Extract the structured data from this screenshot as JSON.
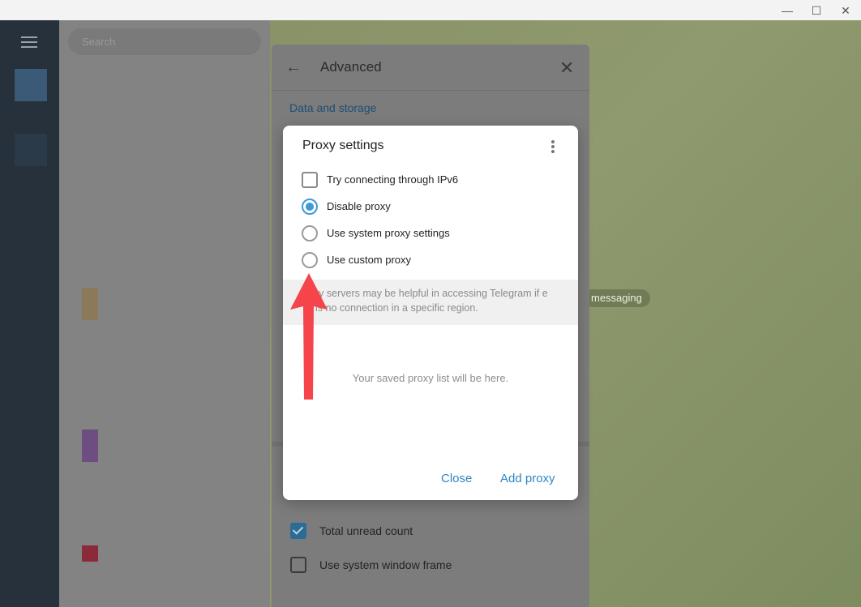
{
  "window": {
    "minimize_glyph": "—",
    "maximize_glyph": "☐",
    "close_glyph": "✕"
  },
  "sidebar": {
    "search_placeholder": "Search"
  },
  "chat": {
    "service_pill": "messaging"
  },
  "advanced_panel": {
    "title": "Advanced",
    "section_title": "Data and storage",
    "options": [
      {
        "label": "Total unread count",
        "checked": true
      },
      {
        "label": "Use system window frame",
        "checked": false
      }
    ]
  },
  "proxy_dialog": {
    "title": "Proxy settings",
    "ipv6_label": "Try connecting through IPv6",
    "ipv6_checked": false,
    "radio_options": [
      {
        "label": "Disable proxy",
        "selected": true
      },
      {
        "label": "Use system proxy settings",
        "selected": false
      },
      {
        "label": "Use custom proxy",
        "selected": false
      }
    ],
    "hint_text": "ry servers may be helpful in accessing Telegram if e is no connection in a specific region.",
    "empty_text": "Your saved proxy list will be here.",
    "close_label": "Close",
    "add_label": "Add proxy"
  },
  "colors": {
    "accent": "#3d9ad6",
    "annotation_arrow": "#f5454b"
  }
}
